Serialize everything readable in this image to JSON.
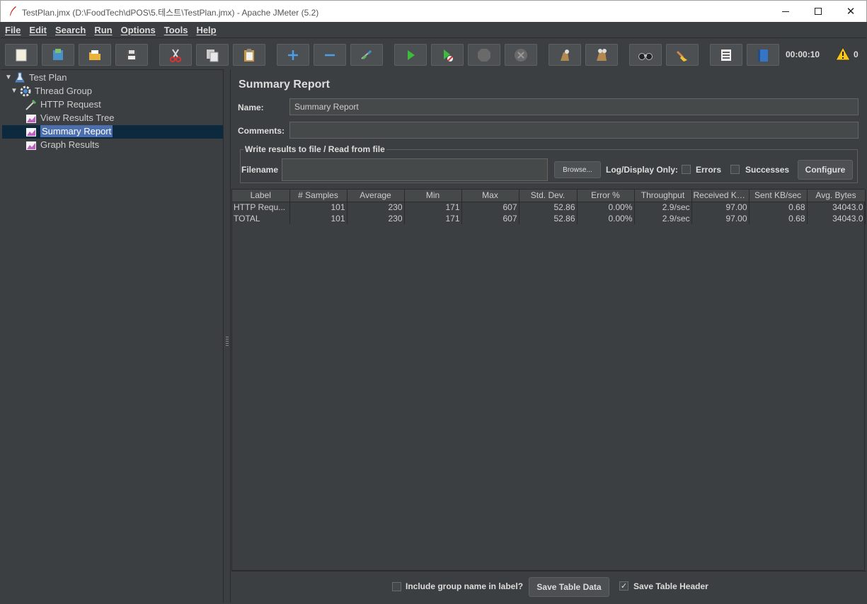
{
  "window": {
    "title": "TestPlan.jmx (D:\\FoodTech\\dPOS\\5.테스트\\TestPlan.jmx) - Apache JMeter (5.2)",
    "minimize_glyph": "",
    "maximize_glyph": "",
    "close_glyph": "✕"
  },
  "menu": [
    "File",
    "Edit",
    "Search",
    "Run",
    "Options",
    "Tools",
    "Help"
  ],
  "toolbar": {
    "buttons": [
      "new-icon",
      "templates-icon",
      "open-icon",
      "save-icon",
      "cut-icon",
      "copy-icon",
      "paste-icon",
      "expand-all-icon",
      "collapse-all-icon",
      "toggle-icon",
      "start-icon",
      "start-no-timers-icon",
      "stop-icon",
      "shutdown-icon",
      "clear-icon",
      "clear-all-icon",
      "search-icon",
      "reset-search-icon",
      "function-helper-icon",
      "help-icon"
    ],
    "timer": "00:00:10",
    "warning_count": "0"
  },
  "tree": {
    "items": [
      {
        "label": "Test Plan",
        "icon": "test-plan-icon"
      },
      {
        "label": "Thread Group",
        "icon": "gear-icon"
      },
      {
        "label": "HTTP Request",
        "icon": "pipette-icon"
      },
      {
        "label": "View Results Tree",
        "icon": "listener-icon"
      },
      {
        "label": "Summary Report",
        "icon": "listener-icon"
      },
      {
        "label": "Graph Results",
        "icon": "listener-icon"
      }
    ]
  },
  "panel": {
    "title": "Summary Report",
    "name_label": "Name:",
    "name_value": "Summary Report",
    "comments_label": "Comments:",
    "comments_value": "",
    "file_group_title": "Write results to file / Read from file",
    "filename_label": "Filename",
    "filename_value": "",
    "browse_label": "Browse...",
    "log_display_label": "Log/Display Only:",
    "errors_label": "Errors",
    "successes_label": "Successes",
    "configure_label": "Configure"
  },
  "table": {
    "headers": [
      "Label",
      "# Samples",
      "Average",
      "Min",
      "Max",
      "Std. Dev.",
      "Error %",
      "Throughput",
      "Received KB...",
      "Sent KB/sec",
      "Avg. Bytes"
    ],
    "rows": [
      [
        "HTTP Requ...",
        "101",
        "230",
        "171",
        "607",
        "52.86",
        "0.00%",
        "2.9/sec",
        "97.00",
        "0.68",
        "34043.0"
      ],
      [
        "TOTAL",
        "101",
        "230",
        "171",
        "607",
        "52.86",
        "0.00%",
        "2.9/sec",
        "97.00",
        "0.68",
        "34043.0"
      ]
    ]
  },
  "bottom": {
    "include_group_label": "Include group name in label?",
    "include_group_checked": false,
    "save_table_data_label": "Save Table Data",
    "save_table_header_label": "Save Table Header",
    "save_table_header_checked": true,
    "check_glyph": "✓"
  }
}
